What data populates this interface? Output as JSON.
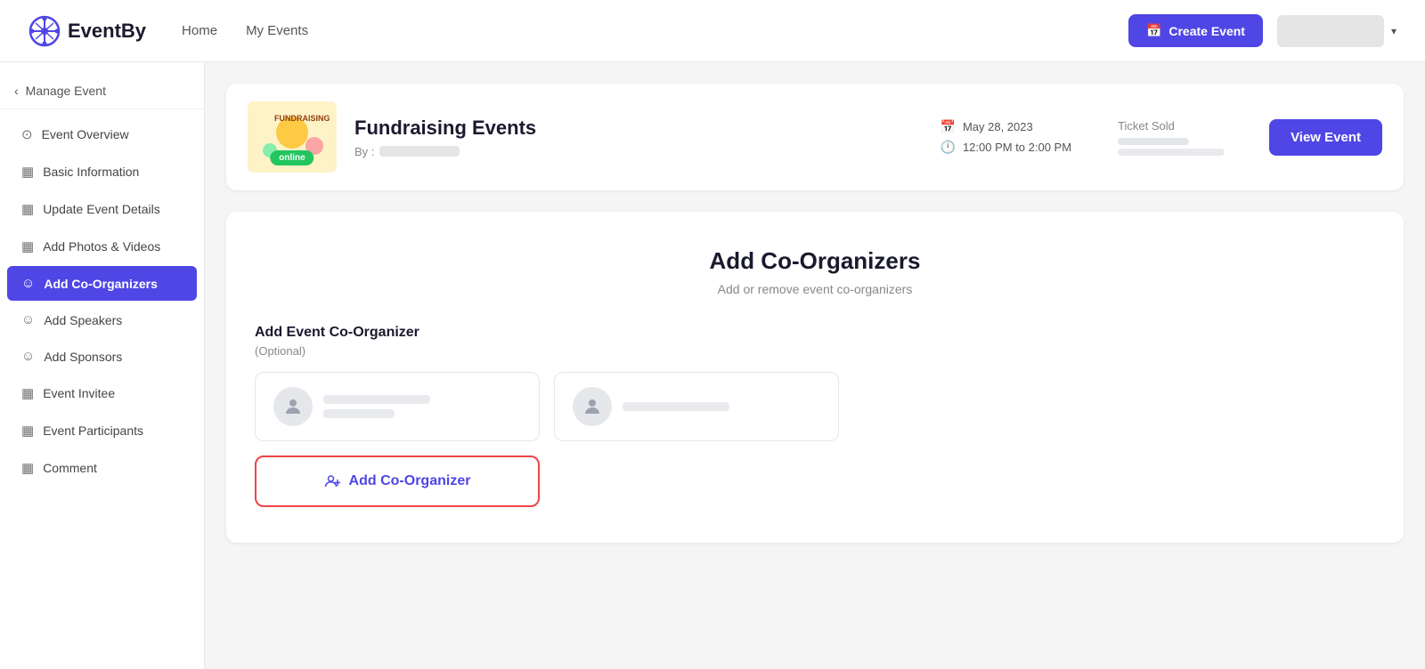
{
  "topnav": {
    "logo_text": "EventBy",
    "links": [
      "Home",
      "My Events"
    ],
    "create_event_label": "Create Event",
    "user_dropdown_chevron": "▾"
  },
  "sidebar": {
    "back_label": "Manage Event",
    "items": [
      {
        "id": "event-overview",
        "label": "Event Overview",
        "icon": "⊙",
        "active": false
      },
      {
        "id": "basic-information",
        "label": "Basic Information",
        "icon": "▦",
        "active": false
      },
      {
        "id": "update-event-details",
        "label": "Update Event Details",
        "icon": "▦",
        "active": false
      },
      {
        "id": "add-photos-videos",
        "label": "Add Photos & Videos",
        "icon": "▦",
        "active": false
      },
      {
        "id": "add-co-organizers",
        "label": "Add Co-Organizers",
        "icon": "☺",
        "active": true
      },
      {
        "id": "add-speakers",
        "label": "Add Speakers",
        "icon": "☺",
        "active": false
      },
      {
        "id": "add-sponsors",
        "label": "Add Sponsors",
        "icon": "☺",
        "active": false
      },
      {
        "id": "event-invitee",
        "label": "Event Invitee",
        "icon": "▦",
        "active": false
      },
      {
        "id": "event-participants",
        "label": "Event Participants",
        "icon": "▦",
        "active": false
      },
      {
        "id": "comment",
        "label": "Comment",
        "icon": "▦",
        "active": false
      }
    ]
  },
  "event_card": {
    "title": "Fundraising Events",
    "by_label": "By :",
    "event_type": "online",
    "date": "May 28, 2023",
    "time": "12:00 PM to 2:00 PM",
    "ticket_sold_label": "Ticket Sold",
    "view_event_label": "View Event"
  },
  "co_organizers": {
    "title": "Add Co-Organizers",
    "subtitle": "Add or remove event co-organizers",
    "form_label": "Add Event Co-Organizer",
    "optional": "(Optional)",
    "add_button_label": "Add Co-Organizer",
    "cards": [
      {
        "id": "card-1"
      },
      {
        "id": "card-2"
      }
    ]
  }
}
